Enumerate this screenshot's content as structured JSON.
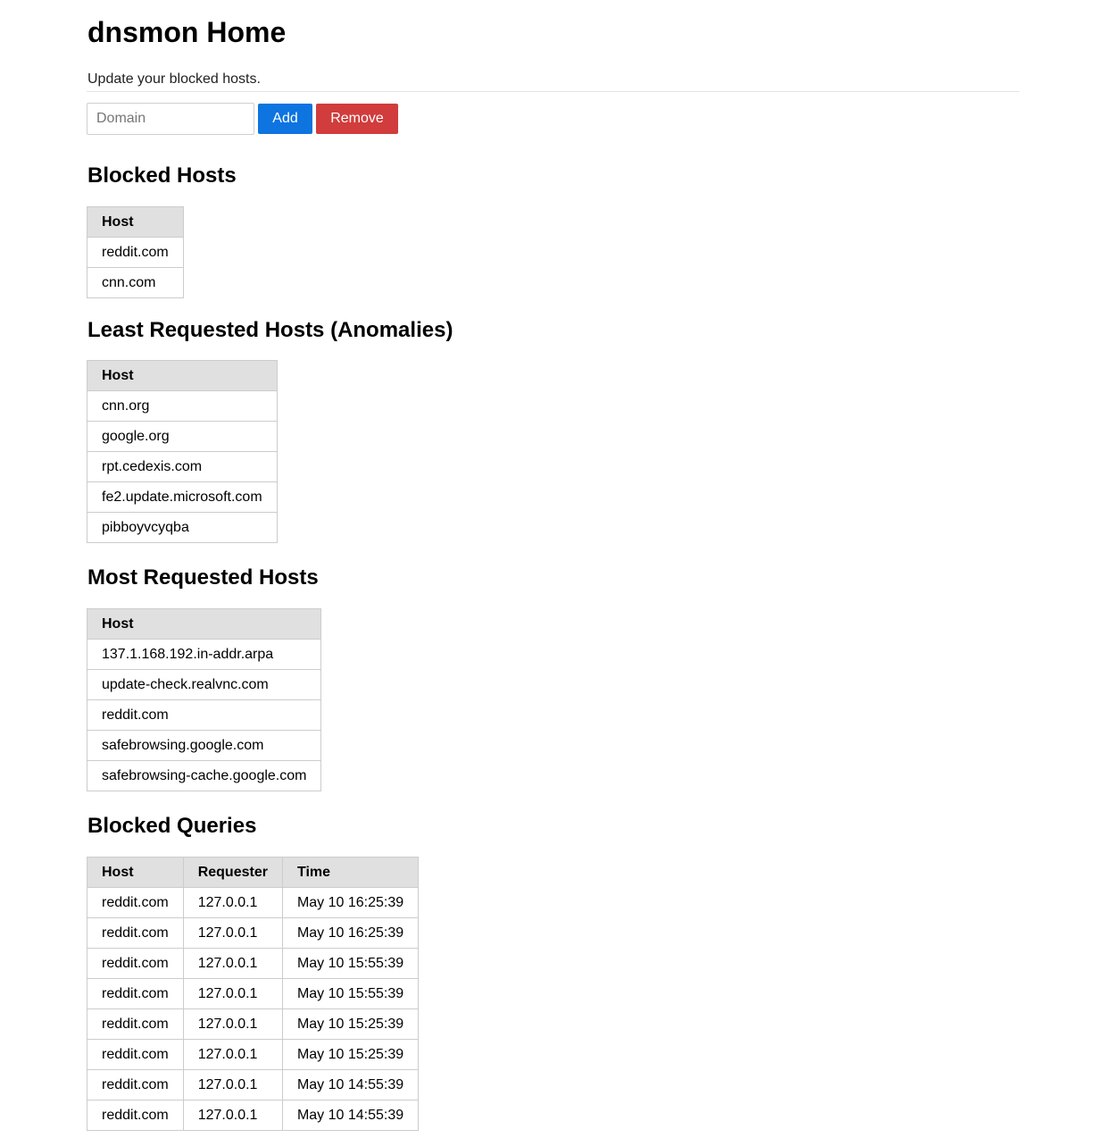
{
  "page": {
    "title": "dnsmon Home",
    "subtitle": "Update your blocked hosts."
  },
  "form": {
    "domain_placeholder": "Domain",
    "domain_value": "",
    "add_label": "Add",
    "remove_label": "Remove"
  },
  "colors": {
    "add_button": "#0d74e0",
    "remove_button": "#d13c3c",
    "table_header_bg": "#e0e0e0",
    "border": "#cccccc"
  },
  "blocked_hosts": {
    "heading": "Blocked Hosts",
    "columns": [
      "Host"
    ],
    "rows": [
      [
        "reddit.com"
      ],
      [
        "cnn.com"
      ]
    ]
  },
  "least_requested": {
    "heading": "Least Requested Hosts (Anomalies)",
    "columns": [
      "Host"
    ],
    "rows": [
      [
        "cnn.org"
      ],
      [
        "google.org"
      ],
      [
        "rpt.cedexis.com"
      ],
      [
        "fe2.update.microsoft.com"
      ],
      [
        "pibboyvcyqba"
      ]
    ]
  },
  "most_requested": {
    "heading": "Most Requested Hosts",
    "columns": [
      "Host"
    ],
    "rows": [
      [
        "137.1.168.192.in-addr.arpa"
      ],
      [
        "update-check.realvnc.com"
      ],
      [
        "reddit.com"
      ],
      [
        "safebrowsing.google.com"
      ],
      [
        "safebrowsing-cache.google.com"
      ]
    ]
  },
  "blocked_queries": {
    "heading": "Blocked Queries",
    "columns": [
      "Host",
      "Requester",
      "Time"
    ],
    "rows": [
      [
        "reddit.com",
        "127.0.0.1",
        "May 10 16:25:39"
      ],
      [
        "reddit.com",
        "127.0.0.1",
        "May 10 16:25:39"
      ],
      [
        "reddit.com",
        "127.0.0.1",
        "May 10 15:55:39"
      ],
      [
        "reddit.com",
        "127.0.0.1",
        "May 10 15:55:39"
      ],
      [
        "reddit.com",
        "127.0.0.1",
        "May 10 15:25:39"
      ],
      [
        "reddit.com",
        "127.0.0.1",
        "May 10 15:25:39"
      ],
      [
        "reddit.com",
        "127.0.0.1",
        "May 10 14:55:39"
      ],
      [
        "reddit.com",
        "127.0.0.1",
        "May 10 14:55:39"
      ]
    ]
  }
}
